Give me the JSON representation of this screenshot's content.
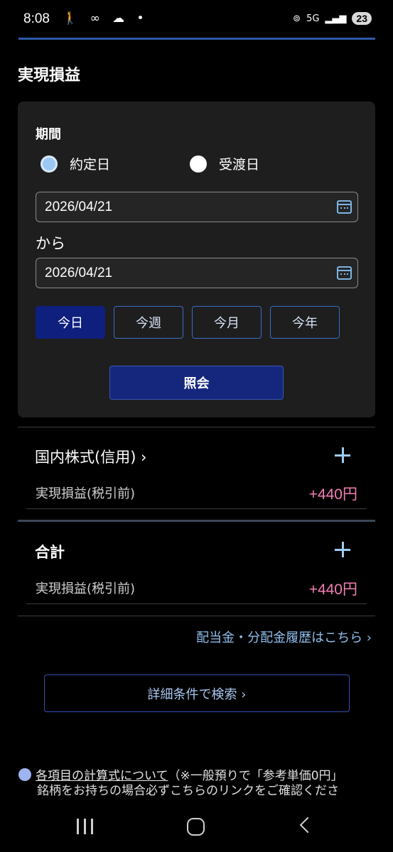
{
  "status_bar": {
    "time": "8:08",
    "left_icons": "🚶 ∞ ☁ •",
    "network": "5G",
    "battery": "23"
  },
  "page": {
    "title": "実現損益"
  },
  "filter": {
    "period_label": "期間",
    "radio_options": [
      {
        "label": "約定日",
        "checked": true
      },
      {
        "label": "受渡日",
        "checked": false
      }
    ],
    "date_from": "2026/04/21",
    "from_label": "から",
    "date_to": "2026/04/21",
    "period_buttons": [
      {
        "label": "今日",
        "active": true
      },
      {
        "label": "今週",
        "active": false
      },
      {
        "label": "今月",
        "active": false
      },
      {
        "label": "今年",
        "active": false
      }
    ],
    "query_button": "照会"
  },
  "sections": [
    {
      "title": "国内株式(信用) ›",
      "row_label": "実現損益(税引前)",
      "row_value": "+440円"
    },
    {
      "title": "合計",
      "row_label": "実現損益(税引前)",
      "row_value": "+440円"
    }
  ],
  "links": {
    "dividend_history": "配当金・分配金履歴はこちら ›",
    "detail_search": "詳細条件で検索 ›"
  },
  "note": {
    "link_text": "各項目の計算式について",
    "text1": "（※一般預りで「参考単価0円」",
    "text2": "銘柄をお持ちの場合必ずこちらのリンクをご確認くださ"
  },
  "colors": {
    "accent_blue": "#0f1f7d",
    "profit_pink": "#f27eb5",
    "link_blue": "#8fbfed"
  }
}
